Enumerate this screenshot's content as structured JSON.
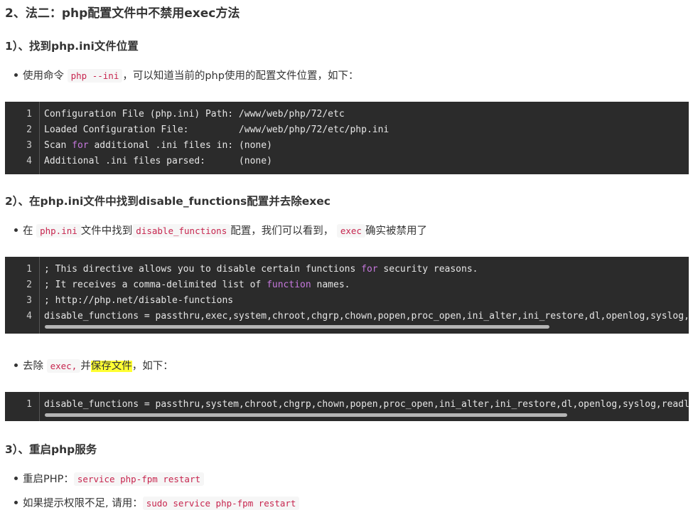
{
  "heading_main": "2、法二：php配置文件中不禁用exec方法",
  "s1": {
    "heading": "1）、找到php.ini文件位置",
    "bullet": {
      "pre": "使用命令",
      "code": "php --ini",
      "post": "，可以知道当前的php使用的配置文件位置，如下："
    },
    "code_lines": [
      {
        "num": "1",
        "parts": [
          "Configuration File (php.ini) Path: /www/web/php/72/etc"
        ]
      },
      {
        "num": "2",
        "parts": [
          "Loaded Configuration File:         /www/web/php/72/etc/php.ini"
        ]
      },
      {
        "num": "3",
        "pre": "Scan ",
        "kw": "for",
        "post": " additional .ini files in: (none)"
      },
      {
        "num": "4",
        "parts": [
          "Additional .ini files parsed:      (none)"
        ]
      }
    ]
  },
  "s2": {
    "heading": "2）、在php.ini文件中找到disable_functions配置并去除exec",
    "bullet": {
      "t1": "在",
      "c1": "php.ini",
      "t2": "文件中找到",
      "c2": "disable_functions",
      "t3": "配置，我们可以看到，",
      "c3": "exec",
      "t4": "确实被禁用了"
    },
    "code_lines": [
      {
        "num": "1",
        "pre": "; This directive allows you to disable certain functions ",
        "kw": "for",
        "post": " security reasons."
      },
      {
        "num": "2",
        "pre": "; It receives a comma-delimited list of ",
        "kw": "function",
        "post": " names."
      },
      {
        "num": "3",
        "text": "; http://php.net/disable-functions"
      },
      {
        "num": "4",
        "text": "disable_functions = passthru,exec,system,chroot,chgrp,chown,popen,proc_open,ini_alter,ini_restore,dl,openlog,syslog,"
      }
    ],
    "bullet2": {
      "t1": "去除",
      "c1": "exec,",
      "t2": "并",
      "hl": "保存文件",
      "t3": "，如下："
    },
    "code2": {
      "num": "1",
      "text": "disable_functions = passthru,system,chroot,chgrp,chown,popen,proc_open,ini_alter,ini_restore,dl,openlog,syslog,readl"
    }
  },
  "s3": {
    "heading": "3）、重启php服务",
    "b1": {
      "t": "重启PHP：",
      "c": "service php-fpm restart"
    },
    "b2": {
      "t": "如果提示权限不足, 请用：",
      "c": "sudo service php-fpm restart"
    }
  }
}
